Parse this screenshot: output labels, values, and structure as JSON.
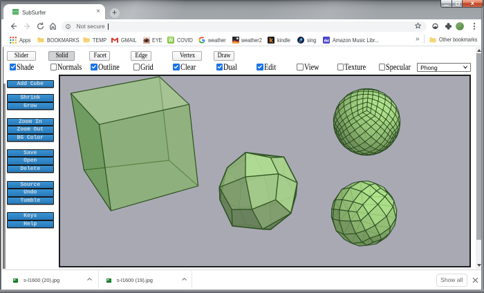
{
  "window": {
    "title": "SubSurfer",
    "controls": {
      "minimize": "minimize",
      "maximize": "maximize",
      "close": "close",
      "close_glyph": "x"
    }
  },
  "tab": {
    "title": "SubSurfer",
    "close_icon": "×",
    "new_tab_icon": "+"
  },
  "address_bar": {
    "security_label": "Not secure"
  },
  "bookmarks_bar": {
    "items": [
      {
        "label": "Apps",
        "icon": "apps-grid"
      },
      {
        "label": "BOOKMARKS",
        "icon": "folder"
      },
      {
        "label": "TEMP",
        "icon": "folder"
      },
      {
        "label": "GMAIL",
        "icon": "gmail"
      },
      {
        "label": "EYE",
        "icon": "photo-eye"
      },
      {
        "label": "COVID",
        "icon": "green-w"
      },
      {
        "label": "weather",
        "icon": "google-g"
      },
      {
        "label": "weather2",
        "icon": "photo-dark"
      },
      {
        "label": "kindle",
        "icon": "kindle"
      },
      {
        "label": "sing",
        "icon": "smule"
      },
      {
        "label": "Amazon Music Libr...",
        "icon": "amazon-music"
      }
    ],
    "overflow_icon": "»",
    "other_bookmarks": "Other bookmarks"
  },
  "toolbar_buttons": [
    {
      "label": "Slider",
      "active": false
    },
    {
      "label": "Solid",
      "active": true
    },
    {
      "label": "Facet",
      "active": false
    },
    {
      "label": "Edge",
      "active": false
    },
    {
      "label": "Vertex",
      "active": false
    },
    {
      "label": "Draw",
      "active": false
    }
  ],
  "checkboxes": [
    {
      "label": "Shade",
      "checked": true
    },
    {
      "label": "Normals",
      "checked": false
    },
    {
      "label": "Outline",
      "checked": true
    },
    {
      "label": "Grid",
      "checked": false
    },
    {
      "label": "Clear",
      "checked": true
    },
    {
      "label": "Dual",
      "checked": true
    },
    {
      "label": "Edit",
      "checked": true
    },
    {
      "label": "View",
      "checked": false
    },
    {
      "label": "Texture",
      "checked": false
    },
    {
      "label": "Specular",
      "checked": false
    }
  ],
  "shading_select": {
    "value": "Phong"
  },
  "sidebar": {
    "groups": [
      [
        "Add Cube"
      ],
      [
        "Shrink",
        "Grow"
      ],
      [
        "Zoom In",
        "Zoom Out",
        "BG Color"
      ],
      [
        "Save",
        "Open",
        "Delete"
      ],
      [
        "Source",
        "Undo",
        "Tumble"
      ],
      [
        "Keys",
        "Help"
      ]
    ]
  },
  "downloads_bar": {
    "items": [
      {
        "filename": "s-l1600 (20).jpg"
      },
      {
        "filename": "s-l1600 (19).jpg"
      }
    ],
    "show_all_label": "Show all",
    "close_icon": "×"
  },
  "colors": {
    "canvas_bg": "#a9a9b4",
    "sidebar_button": "#2b83c4",
    "accent_checkbox": "#1a73e8",
    "close_button": "#d35940"
  }
}
